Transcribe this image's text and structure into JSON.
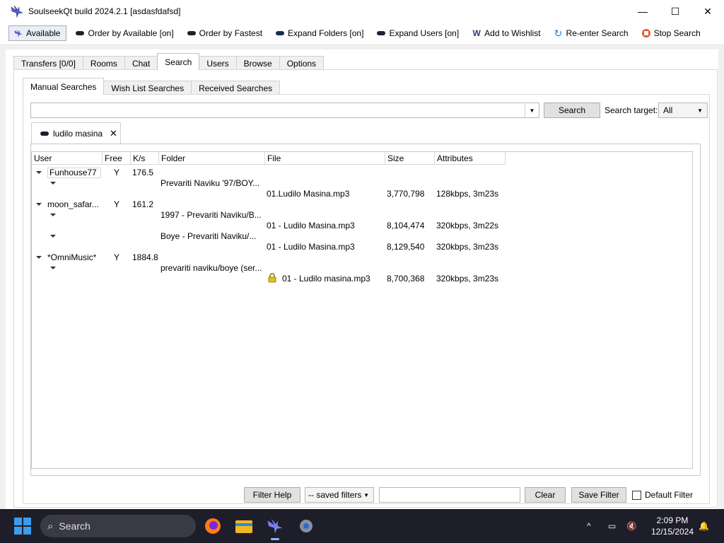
{
  "window": {
    "title": "SoulseekQt build 2024.2.1 [asdasfdafsd]",
    "controls": [
      "minimize",
      "maximize",
      "close"
    ]
  },
  "toolbar": {
    "available": "Available",
    "order_available": "Order by Available [on]",
    "order_fastest": "Order by Fastest",
    "expand_folders": "Expand Folders [on]",
    "expand_users": "Expand Users [on]",
    "add_wishlist": "Add to Wishlist",
    "reenter_search": "Re-enter Search",
    "stop_search": "Stop Search"
  },
  "main_tabs": [
    {
      "label": "Transfers [0/0]",
      "active": false
    },
    {
      "label": "Rooms",
      "active": false
    },
    {
      "label": "Chat",
      "active": false
    },
    {
      "label": "Search",
      "active": true
    },
    {
      "label": "Users",
      "active": false
    },
    {
      "label": "Browse",
      "active": false
    },
    {
      "label": "Options",
      "active": false
    }
  ],
  "sub_tabs": [
    {
      "label": "Manual Searches",
      "active": true
    },
    {
      "label": "Wish List Searches",
      "active": false
    },
    {
      "label": "Received Searches",
      "active": false
    }
  ],
  "search": {
    "query_value": "",
    "button_label": "Search",
    "target_label": "Search target:",
    "target_value": "All"
  },
  "result_tab": {
    "label": "ludilo masina"
  },
  "columns": [
    "User",
    "Free",
    "K/s",
    "Folder",
    "File",
    "Size",
    "Attributes"
  ],
  "results": [
    {
      "user": "Funhouse77",
      "free": "Y",
      "speed": "176.5",
      "folders": [
        {
          "folder": "Prevariti Naviku '97/BOY...",
          "files": [
            {
              "file": "01.Ludilo Masina.mp3",
              "size": "3,770,798",
              "attrs": "128kbps, 3m23s",
              "locked": false
            }
          ]
        }
      ]
    },
    {
      "user": "moon_safar...",
      "free": "Y",
      "speed": "161.2",
      "folders": [
        {
          "folder": "1997 - Prevariti Naviku/B...",
          "files": [
            {
              "file": "01 - Ludilo Masina.mp3",
              "size": "8,104,474",
              "attrs": "320kbps, 3m22s",
              "locked": false
            }
          ]
        },
        {
          "folder": "Boye - Prevariti Naviku/...",
          "files": [
            {
              "file": "01 - Ludilo Masina.mp3",
              "size": "8,129,540",
              "attrs": "320kbps, 3m23s",
              "locked": false
            }
          ]
        }
      ]
    },
    {
      "user": "*OmniMusic*",
      "free": "Y",
      "speed": "1884.8",
      "folders": [
        {
          "folder": "prevariti naviku/boye (ser...",
          "files": [
            {
              "file": "01 - Ludilo masina.mp3",
              "size": "8,700,368",
              "attrs": "320kbps, 3m23s",
              "locked": true
            }
          ]
        }
      ]
    }
  ],
  "filters": {
    "help_label": "Filter Help",
    "saved_label": "-- saved filters",
    "input_value": "",
    "clear_label": "Clear",
    "save_label": "Save Filter",
    "default_label": "Default Filter",
    "default_checked": false
  },
  "taskbar": {
    "search_placeholder": "Search",
    "time": "2:09 PM",
    "date": "12/15/2024"
  },
  "colors": {
    "accent": "#3a9df0",
    "taskbar_bg": "#1e1e2a",
    "lock": "#e8c300"
  }
}
